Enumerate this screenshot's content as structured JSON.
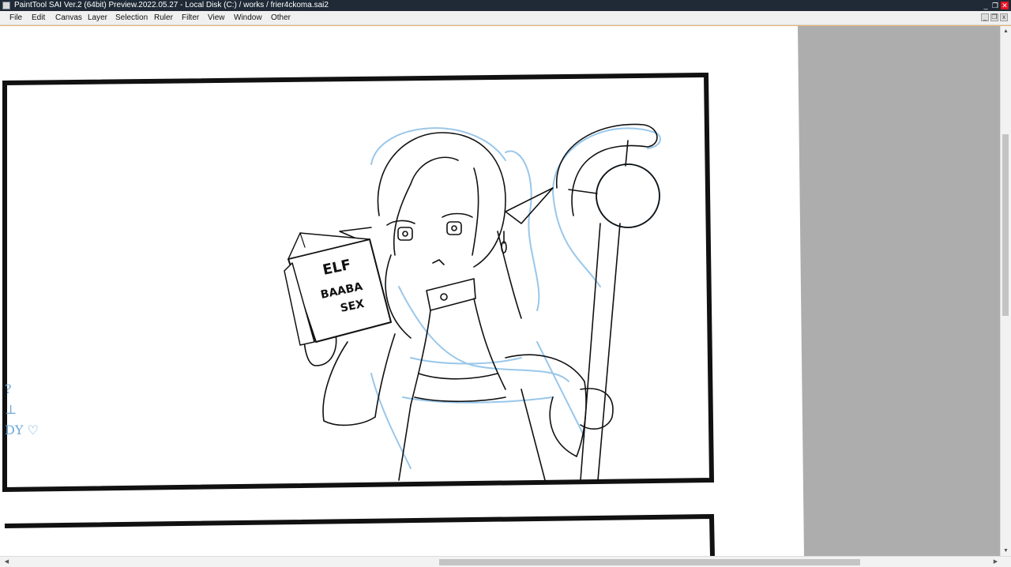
{
  "titlebar": {
    "title": "PaintTool SAI Ver.2 (64bit) Preview.2022.05.27 - Local Disk (C:) / works / frier4ckoma.sai2",
    "icon": "app-icon",
    "minimize_glyph": "_",
    "restore_glyph": "❐",
    "close_glyph": "✕"
  },
  "menubar": {
    "items": [
      {
        "label": "File"
      },
      {
        "label": "Edit"
      },
      {
        "label": "Canvas"
      },
      {
        "label": "Layer"
      },
      {
        "label": "Selection"
      },
      {
        "label": "Ruler"
      },
      {
        "label": "Filter"
      },
      {
        "label": "View"
      },
      {
        "label": "Window"
      },
      {
        "label": "Other"
      }
    ],
    "mdi_minimize_glyph": "_",
    "mdi_restore_glyph": "❐",
    "mdi_close_glyph": "x"
  },
  "canvas": {
    "book_text": [
      "ELF",
      "BAABA",
      "SEX"
    ],
    "side_notes": [
      "?",
      "⊥",
      "DY ♡"
    ]
  },
  "colors": {
    "titlebar_bg": "#1f2a36",
    "close_button": "#e81123",
    "sketch_blue": "#8fc1e8",
    "lineart": "#111111",
    "gray_area": "#adadad"
  },
  "scrollbars": {
    "vertical": {
      "arrow_up": "▲",
      "arrow_down": "▼"
    },
    "horizontal": {
      "arrow_left": "◀",
      "arrow_right": "▶"
    }
  }
}
